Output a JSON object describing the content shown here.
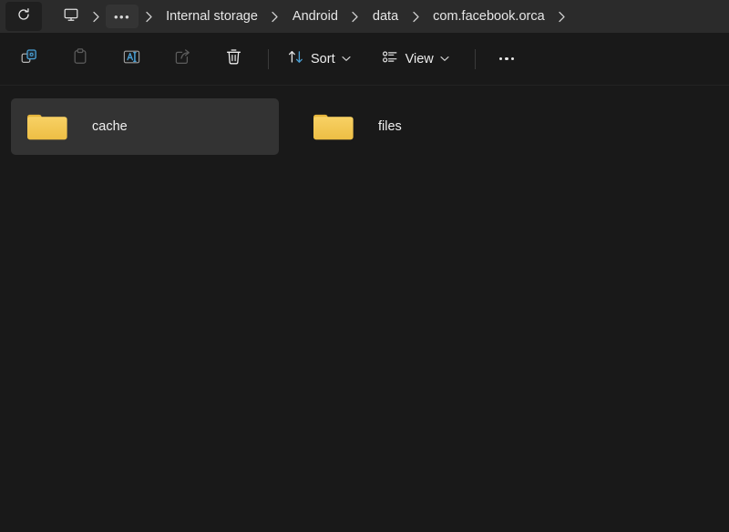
{
  "window": {
    "app": "File Explorer",
    "theme": "dark"
  },
  "addressbar": {
    "refresh_icon": "refresh-icon",
    "this_pc_icon": "monitor-icon",
    "overflow_label": "•••",
    "crumbs": [
      {
        "label": "Internal storage",
        "icon": null
      },
      {
        "label": "Android",
        "icon": null
      },
      {
        "label": "data",
        "icon": null
      },
      {
        "label": "com.facebook.orca",
        "icon": null
      }
    ]
  },
  "toolbar": {
    "icon_buttons": [
      {
        "name": "copy-icon",
        "label": "Copy",
        "disabled": false
      },
      {
        "name": "paste-icon",
        "label": "Paste",
        "disabled": true
      },
      {
        "name": "rename-icon",
        "label": "Rename",
        "disabled": false
      },
      {
        "name": "share-icon",
        "label": "Share",
        "disabled": true
      },
      {
        "name": "delete-icon",
        "label": "Delete",
        "disabled": false
      }
    ],
    "sort_label": "Sort",
    "view_label": "View",
    "more_label": "See more"
  },
  "content": {
    "items": [
      {
        "name": "cache",
        "type": "folder",
        "selected": true
      },
      {
        "name": "files",
        "type": "folder",
        "selected": false
      }
    ]
  },
  "colors": {
    "accent_blue": "#4a9fd4",
    "folder_body": "#f2c14b",
    "folder_tab": "#e8b93c",
    "window_bg": "#191919",
    "addressbar_bg": "#2b2b2b",
    "selection_bg": "#333333",
    "text_primary": "#f0f0f0"
  }
}
